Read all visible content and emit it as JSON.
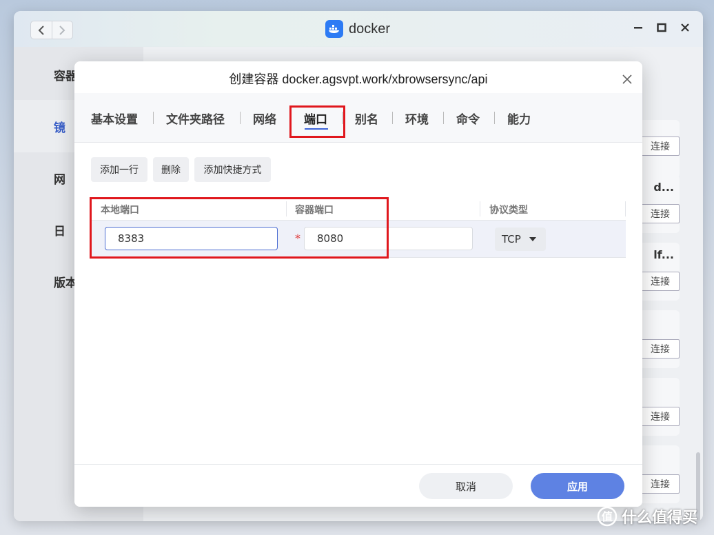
{
  "window": {
    "app_title": "docker"
  },
  "sidebar": {
    "items": [
      {
        "label": "容器"
      },
      {
        "label": "镜"
      },
      {
        "label": "网"
      },
      {
        "label": "日"
      },
      {
        "label": "版本"
      }
    ]
  },
  "background_list": {
    "names": [
      "d...",
      "lf..."
    ],
    "tag_label": "连接"
  },
  "dialog": {
    "title": "创建容器 docker.agsvpt.work/xbrowsersync/api",
    "tabs": [
      {
        "label": "基本设置"
      },
      {
        "label": "文件夹路径"
      },
      {
        "label": "网络"
      },
      {
        "label": "端口"
      },
      {
        "label": "别名"
      },
      {
        "label": "环境"
      },
      {
        "label": "命令"
      },
      {
        "label": "能力"
      }
    ],
    "active_tab": "端口",
    "toolbar": {
      "add_row": "添加一行",
      "delete": "删除",
      "add_shortcut": "添加快捷方式"
    },
    "table": {
      "headers": [
        "本地端口",
        "容器端口",
        "协议类型"
      ],
      "rows": [
        {
          "local_port": "8383",
          "container_port": "8080",
          "protocol": "TCP"
        }
      ]
    },
    "footer": {
      "cancel": "取消",
      "apply": "应用"
    }
  },
  "watermark": {
    "text": "什么值得买"
  },
  "colors": {
    "accent": "#5e82e3",
    "tab_underline": "#3a62d8",
    "highlight_box": "#e0171d",
    "docker_blue": "#2d7bf4"
  }
}
